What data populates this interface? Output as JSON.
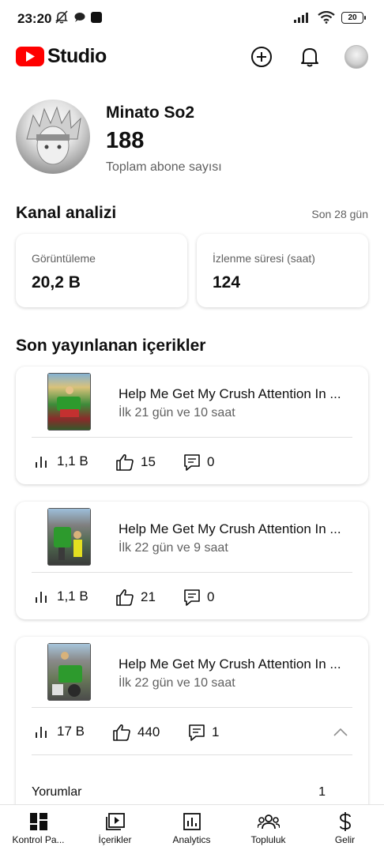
{
  "status_bar": {
    "time": "23:20",
    "battery": "20"
  },
  "app": {
    "logo_text": "Studio"
  },
  "channel": {
    "name": "Minato So2",
    "subscribers": "188",
    "subscribers_label": "Toplam abone sayısı"
  },
  "analytics": {
    "title": "Kanal analizi",
    "period": "Son 28 gün",
    "metrics": [
      {
        "label": "Görüntüleme",
        "value": "20,2 B"
      },
      {
        "label": "İzlenme süresi (saat)",
        "value": "124"
      }
    ]
  },
  "recent": {
    "title": "Son yayınlanan içerikler",
    "videos": [
      {
        "title": "Help Me Get My Crush Attention In ...",
        "subtitle": "İlk 21 gün ve 10 saat",
        "views": "1,1 B",
        "likes": "15",
        "comments": "0"
      },
      {
        "title": "Help Me Get My Crush Attention In ...",
        "subtitle": "İlk 22 gün ve 9 saat",
        "views": "1,1 B",
        "likes": "21",
        "comments": "0"
      },
      {
        "title": "Help Me Get My Crush Attention In ...",
        "subtitle": "İlk 22 gün ve 10 saat",
        "views": "17 B",
        "likes": "440",
        "comments": "1",
        "comments_label": "Yorumlar",
        "comments_count": "1"
      }
    ]
  },
  "nav": {
    "items": [
      {
        "label": "Kontrol Pa...",
        "icon": "dashboard-icon"
      },
      {
        "label": "İçerikler",
        "icon": "content-icon"
      },
      {
        "label": "Analytics",
        "icon": "analytics-icon"
      },
      {
        "label": "Topluluk",
        "icon": "community-icon"
      },
      {
        "label": "Gelir",
        "icon": "earn-icon"
      }
    ]
  },
  "colors": {
    "brand_red": "#ff0000",
    "text_primary": "#0f0f0f",
    "text_secondary": "#606060"
  }
}
